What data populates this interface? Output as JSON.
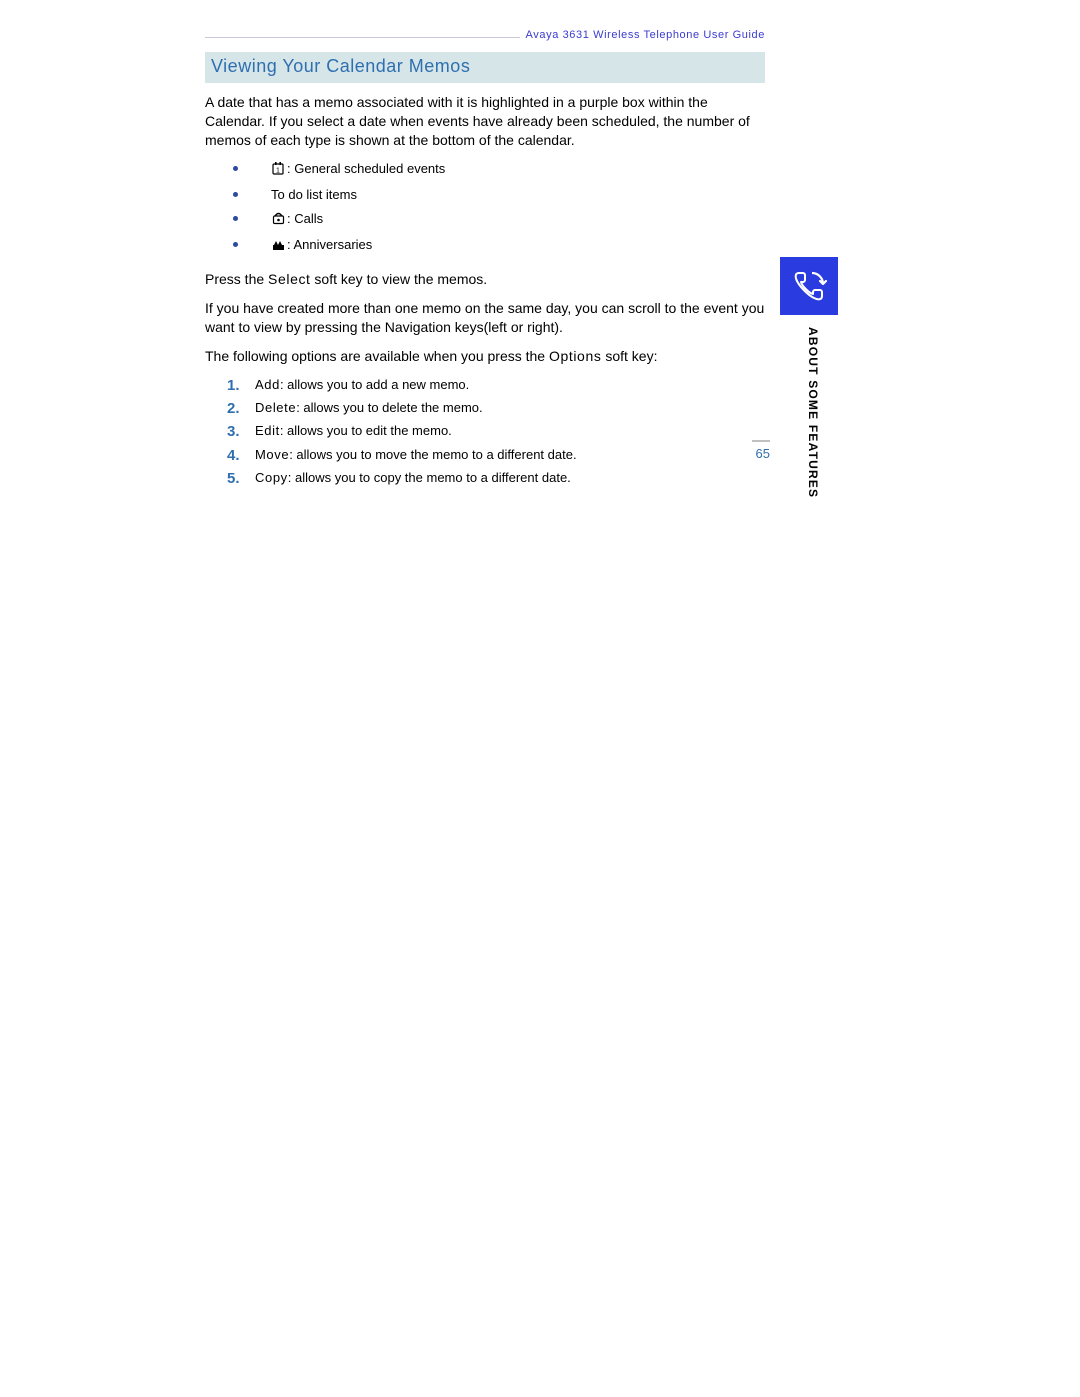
{
  "header": {
    "guide_title": "Avaya 3631 Wireless Telephone User Guide"
  },
  "section": {
    "heading": "Viewing Your Calendar Memos",
    "intro": "A date that has a memo associated with it is highlighted in a purple box within the Calendar. If you select a date when events have already been scheduled, the number of memos of each type is shown at the bottom of the calendar.",
    "memo_types": [
      {
        "icon": "calendar-event-icon",
        "text": ": General scheduled events"
      },
      {
        "icon": "",
        "text": "To do list items"
      },
      {
        "icon": "phone-icon",
        "text": ": Calls"
      },
      {
        "icon": "anniversary-icon",
        "text": ": Anniversaries"
      }
    ],
    "press_select_pre": "Press the ",
    "press_select_key": "Select",
    "press_select_post": " soft key to view the memos.",
    "scroll_note": "If you have created more than one memo on the same day, you can scroll to the event you want to view by pressing the Navigation keys(left or right).",
    "options_intro_pre": "The following options are available when you press the ",
    "options_intro_key": "Options",
    "options_intro_post": " soft key:",
    "options": [
      {
        "term": "Add",
        "desc": ": allows you to add a new memo."
      },
      {
        "term": "Delete",
        "desc": ": allows you to delete the memo."
      },
      {
        "term": "Edit",
        "desc": ": allows you to edit the memo."
      },
      {
        "term": "Move",
        "desc": ": allows you to move the memo to a different date."
      },
      {
        "term": "Copy",
        "desc": ": allows you to copy the memo to a different date."
      }
    ]
  },
  "side": {
    "label": "ABOUT SOME FEATURES"
  },
  "page_number": "65"
}
